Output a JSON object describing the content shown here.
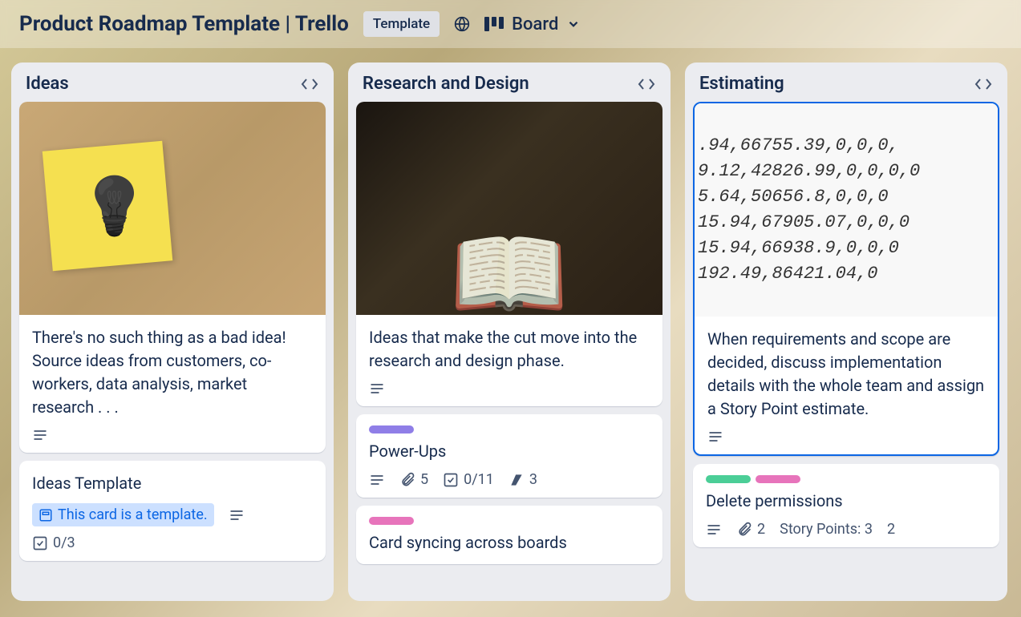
{
  "header": {
    "title": "Product Roadmap Template | Trello",
    "template_badge": "Template",
    "view_label": "Board"
  },
  "lists": [
    {
      "title": "Ideas",
      "cards": [
        {
          "text": "There's no such thing as a bad idea! Source ideas from customers, co-workers, data analysis, market research . . .",
          "has_description": true,
          "cover": "ideas"
        },
        {
          "text": "Ideas Template",
          "is_template": true,
          "template_label": "This card is a template.",
          "has_description": true,
          "checklist": "0/3"
        }
      ]
    },
    {
      "title": "Research and Design",
      "cards": [
        {
          "text": "Ideas that make the cut move into the research and design phase.",
          "has_description": true,
          "cover": "research"
        },
        {
          "text": "Power-Ups",
          "labels": [
            "purple"
          ],
          "has_description": true,
          "attachments": "5",
          "checklist": "0/11",
          "custom_count": "3"
        },
        {
          "text": "Card syncing across boards",
          "labels": [
            "pink"
          ]
        }
      ]
    },
    {
      "title": "Estimating",
      "cards": [
        {
          "text": "When requirements and scope are decided, discuss implementation details with the whole team and assign a Story Point estimate.",
          "has_description": true,
          "cover": "estimating",
          "selected": true
        },
        {
          "text": "Delete permissions",
          "labels": [
            "green",
            "pink"
          ],
          "has_description": true,
          "attachments": "2",
          "story_points_label": "Story Points: 3",
          "extra_count": "2"
        }
      ]
    }
  ],
  "cover_estimating_lines": [
    ".94,66755.39,0,0,0,",
    "9.12,42826.99,0,0,0,0",
    "5.64,50656.8,0,0,0",
    "15.94,67905.07,0,0,0",
    "15.94,66938.9,0,0,0",
    "192.49,86421.04,0"
  ]
}
